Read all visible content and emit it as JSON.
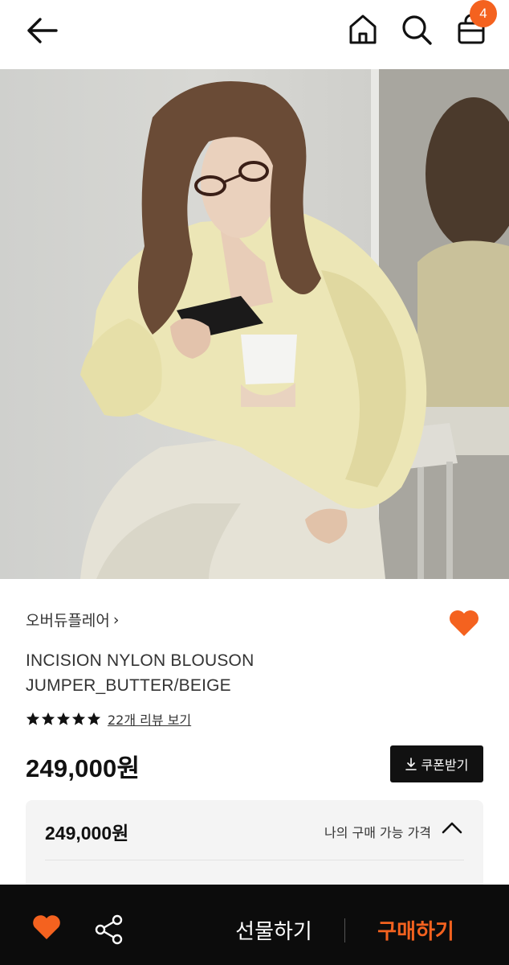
{
  "header": {
    "back_icon": "arrow-left-icon",
    "home_icon": "home-icon",
    "search_icon": "search-icon",
    "cart_icon": "shopping-bag-icon",
    "cart_count": "4"
  },
  "gallery": {
    "image_alt": "Product photo: model in butter-colored sheer nylon blouson jacket",
    "current_slide_fraction": 0.25
  },
  "product": {
    "brand": "오버듀플레어",
    "brand_chevron": "›",
    "title_line1": "INCISION NYLON BLOUSON",
    "title_line2": "JUMPER_BUTTER/BEIGE",
    "rating_stars": 5,
    "review_link": "22개 리뷰 보기",
    "price": "249,000원",
    "coupon_label": "쿠폰받기",
    "wishlisted": true
  },
  "price_panel": {
    "price": "249,000원",
    "label": "나의 구매 가능 가격",
    "expanded": true
  },
  "bottom_bar": {
    "gift_label": "선물하기",
    "buy_label": "구매하기"
  },
  "colors": {
    "accent": "#f4621f",
    "bar_bg": "#0c0c0c",
    "panel_bg": "#f4f4f4"
  }
}
